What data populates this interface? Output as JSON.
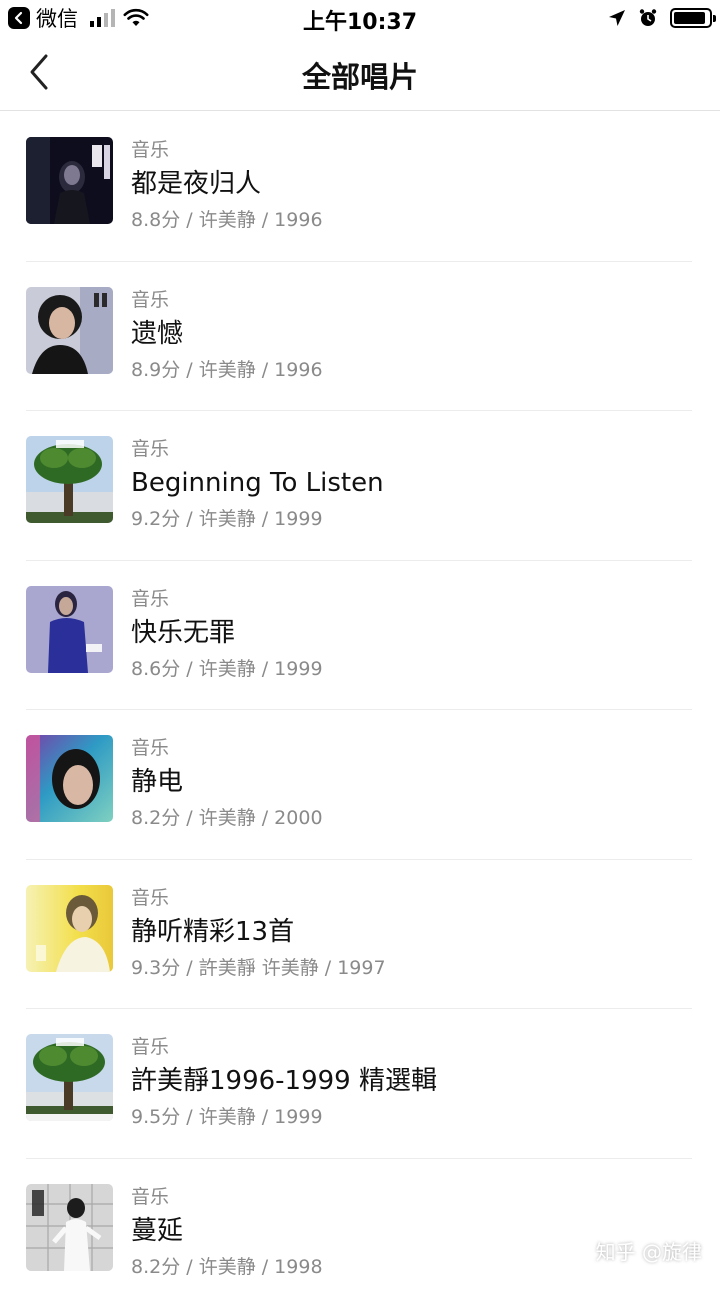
{
  "status_bar": {
    "back_app": "微信",
    "time": "上午10:37",
    "signal_bars": 4,
    "signal_active": 2,
    "battery_level": 0.9
  },
  "nav": {
    "title": "全部唱片"
  },
  "albums": [
    {
      "category": "音乐",
      "title": "都是夜归人",
      "meta": "8.8分 / 许美静 / 1996",
      "cover": "cover-dark"
    },
    {
      "category": "音乐",
      "title": "遗憾",
      "meta": "8.9分 / 许美静 / 1996",
      "cover": "cover-portrait-bw"
    },
    {
      "category": "音乐",
      "title": "Beginning To Listen",
      "meta": "9.2分 / 许美静 / 1999",
      "cover": "cover-tree"
    },
    {
      "category": "音乐",
      "title": "快乐无罪",
      "meta": "8.6分 / 许美静 / 1999",
      "cover": "cover-blue-figure"
    },
    {
      "category": "音乐",
      "title": "静电",
      "meta": "8.2分 / 许美静 / 2000",
      "cover": "cover-colorful-face"
    },
    {
      "category": "音乐",
      "title": "静听精彩13首",
      "meta": "9.3分 / 許美靜 许美静 / 1997",
      "cover": "cover-yellow"
    },
    {
      "category": "音乐",
      "title": "許美靜1996-1999 精選輯",
      "meta": "9.5分 / 许美静 / 1999",
      "cover": "cover-tree-2"
    },
    {
      "category": "音乐",
      "title": "蔓延",
      "meta": "8.2分 / 许美静 / 1998",
      "cover": "cover-grid-figure"
    }
  ],
  "watermark": "知乎 @旋律"
}
